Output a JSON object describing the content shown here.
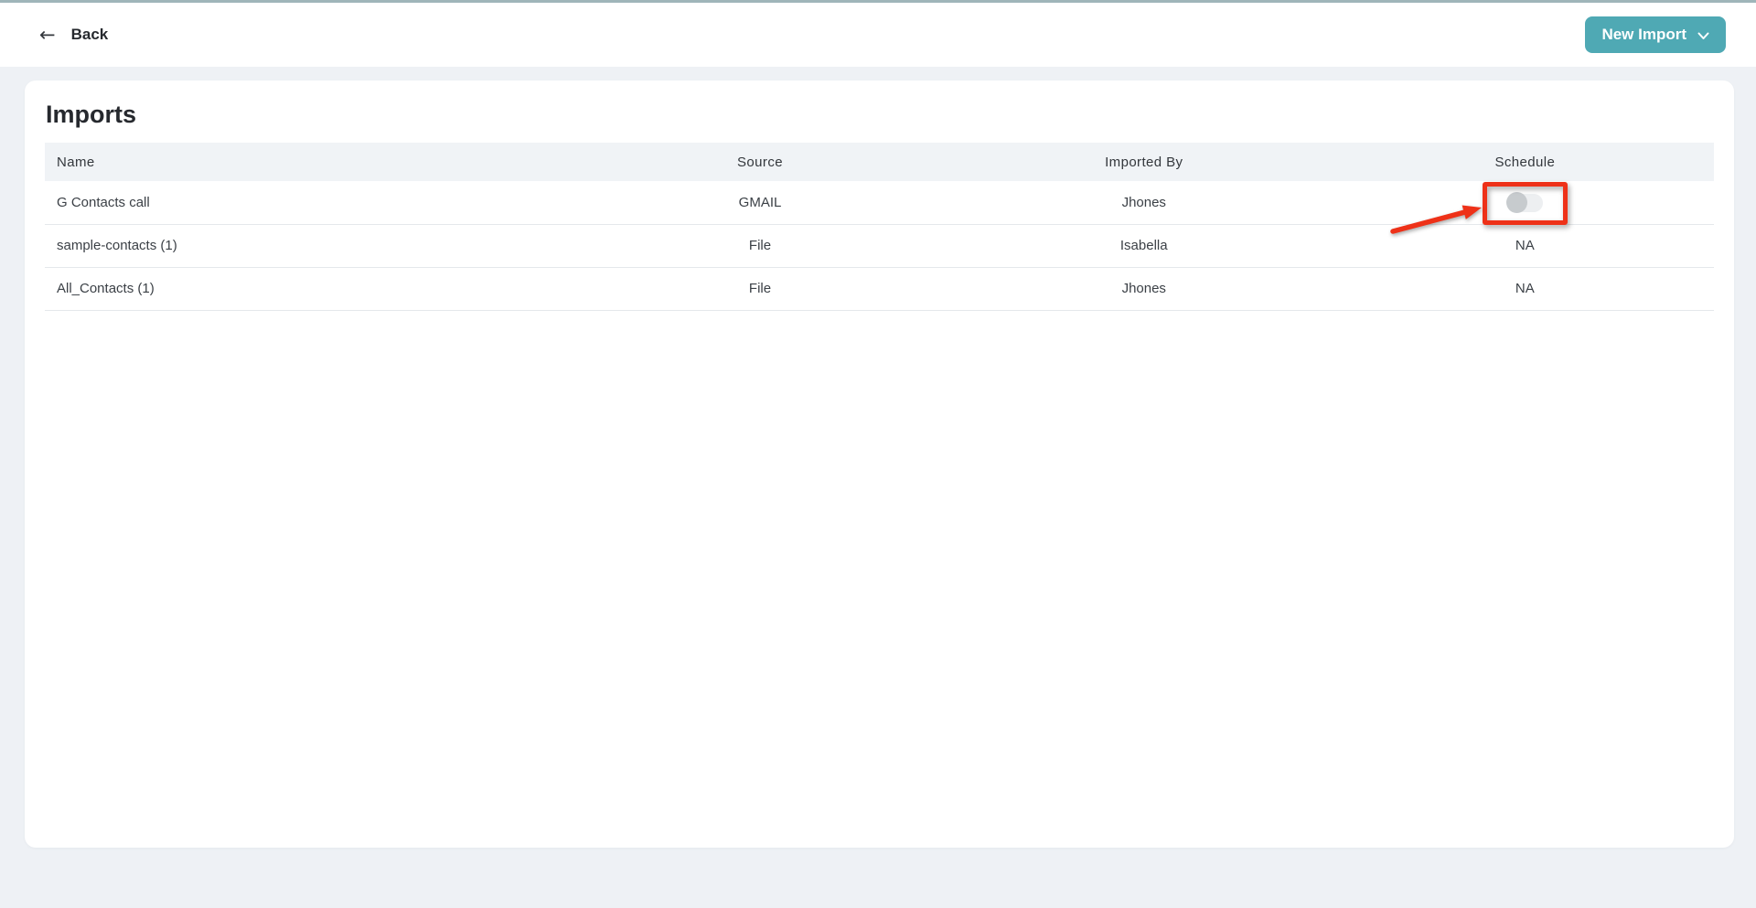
{
  "header": {
    "back_label": "Back",
    "new_import_label": "New Import"
  },
  "page": {
    "title": "Imports"
  },
  "table": {
    "columns": [
      "Name",
      "Source",
      "Imported By",
      "Schedule"
    ],
    "rows": [
      {
        "name": "G Contacts call",
        "source": "GMAIL",
        "imported_by": "Jhones",
        "schedule": "",
        "schedule_control": "toggle",
        "toggle_state": "off"
      },
      {
        "name": "sample-contacts (1)",
        "source": "File",
        "imported_by": "Isabella",
        "schedule": "NA",
        "schedule_control": "text"
      },
      {
        "name": "All_Contacts (1)",
        "source": "File",
        "imported_by": "Jhones",
        "schedule": "NA",
        "schedule_control": "text"
      }
    ]
  },
  "annotation": {
    "type": "red-box-with-arrow",
    "target": "schedule-toggle-of-first-row"
  },
  "colors": {
    "accent_teal": "#4fa9b4",
    "top_line": "#9fb5b9",
    "page_background": "#eef1f5",
    "table_header_background": "#f0f3f6",
    "annotation_red": "#ee3118",
    "toggle_knob": "#c7cbce",
    "toggle_track": "#edeff1"
  }
}
